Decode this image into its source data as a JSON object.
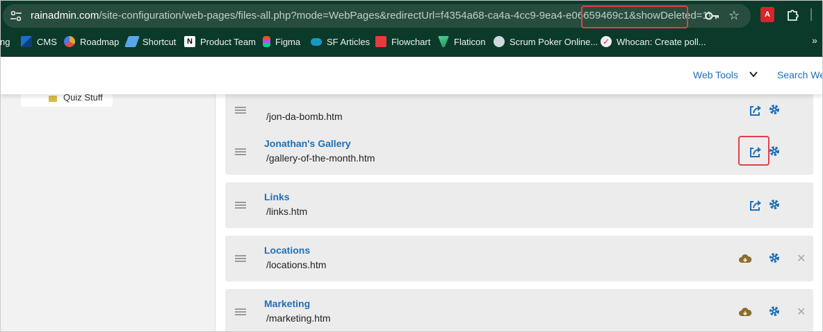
{
  "browser": {
    "url_host": "rainadmin.com",
    "url_path": "/site-configuration/web-pages/files-all.php?mode=WebPages&redirectUrl=f4354a68-ca4a-4cc9-9ea4-e06659469",
    "url_tail": "c1&showDeleted=1\\",
    "pdf_label": "A",
    "bookmarks_more": "»",
    "bookmarks": [
      {
        "label": "ng",
        "icon": "partial-icon",
        "color": "#0b3a2a"
      },
      {
        "label": "CMS",
        "icon": "cms-icon",
        "color": "#1a6fd0"
      },
      {
        "label": "Roadmap",
        "icon": "roadmap-icon",
        "color": "#e8a53a"
      },
      {
        "label": "Shortcut",
        "icon": "shortcut-icon",
        "color": "#58a6e8"
      },
      {
        "label": "Product Team",
        "icon": "notion-icon",
        "color": "#ffffff"
      },
      {
        "label": "Figma",
        "icon": "figma-icon",
        "color": "#f24e1e"
      },
      {
        "label": "SF Articles",
        "icon": "salesforce-icon",
        "color": "#1798c1"
      },
      {
        "label": "Flowchart",
        "icon": "flowchart-icon",
        "color": "#e83a3a"
      },
      {
        "label": "Flaticon",
        "icon": "flaticon-icon",
        "color": "#4ad295"
      },
      {
        "label": "Scrum Poker Online...",
        "icon": "scrum-poker-icon",
        "color": "#cfd8dc"
      },
      {
        "label": "Whocan: Create poll...",
        "icon": "whocan-icon",
        "color": "#f2f2f2"
      }
    ]
  },
  "header": {
    "web_tools": "Web Tools",
    "search": "Search We"
  },
  "sidebar": {
    "item_label": "Quiz Stuff"
  },
  "pages": [
    {
      "title": "",
      "path": "/jon-da-bomb.htm",
      "actions": [
        "share",
        "settings"
      ],
      "deletable": false
    },
    {
      "title": "Jonathan's Gallery",
      "path": "/gallery-of-the-month.htm",
      "actions": [
        "share",
        "settings"
      ],
      "deletable": false
    },
    {
      "title": "Links",
      "path": "/links.htm",
      "actions": [
        "share",
        "settings"
      ],
      "deletable": false
    },
    {
      "title": "Locations",
      "path": "/locations.htm",
      "actions": [
        "download",
        "settings"
      ],
      "deletable": true
    },
    {
      "title": "Marketing",
      "path": "/marketing.htm",
      "actions": [
        "download",
        "settings"
      ],
      "deletable": true
    }
  ],
  "delete_glyph": "✕",
  "colors": {
    "link": "#1e6fb8",
    "highlight": "#e0404a",
    "cloud": "#8c6d2a",
    "chrome": "#0b3a2a"
  }
}
